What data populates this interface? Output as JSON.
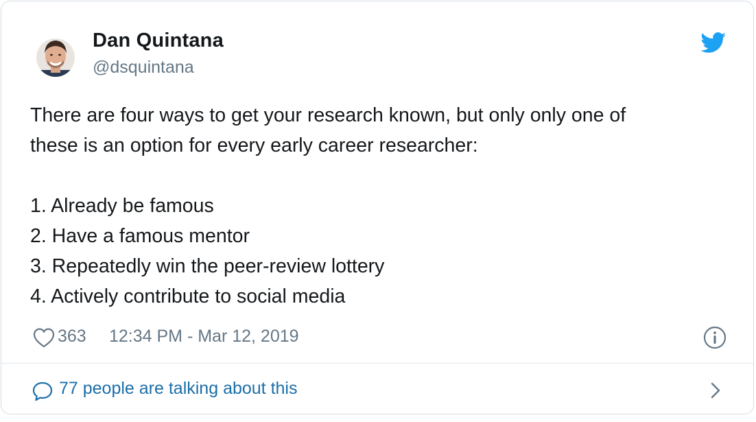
{
  "author": {
    "name": "Dan Quintana",
    "handle": "@dsquintana",
    "avatar_icon": "profile-photo"
  },
  "tweet": {
    "lines": [
      "There are four ways to get your research known, but only only one of",
      "these is an option for every early career researcher:"
    ],
    "list": [
      "1. Already be famous",
      "2. Have a famous mentor",
      "3. Repeatedly win the peer-review lottery",
      "4. Actively contribute to social media"
    ]
  },
  "meta": {
    "likes": "363",
    "timestamp": "12:34 PM - Mar 12, 2019"
  },
  "footer": {
    "talking": "77 people are talking about this"
  },
  "colors": {
    "twitter_blue": "#1da1f2",
    "link_blue": "#1b6ea8",
    "muted_gray": "#657786",
    "text_dark": "#14171a",
    "border": "#d6dde3"
  },
  "icons": {
    "brand": "twitter-bird-icon",
    "like": "heart-icon",
    "info": "info-icon",
    "reply": "speech-bubble-icon",
    "more": "chevron-right-icon"
  }
}
